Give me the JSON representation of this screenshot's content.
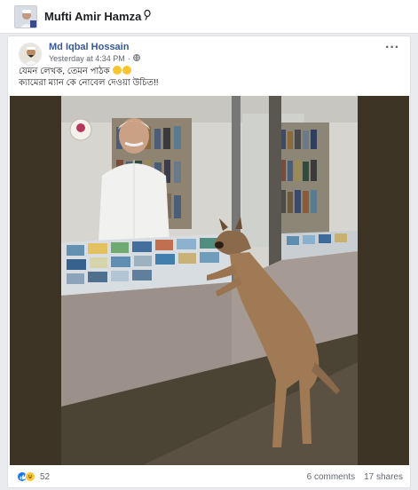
{
  "page": {
    "name": "Mufti Amir Hamza",
    "pin_icon": "pushpin-icon"
  },
  "post": {
    "author": "Md Iqbal Hossain",
    "timestamp": "Yesterday at 4:34 PM",
    "privacy_icon": "globe-icon",
    "text_line1": "যেমন লেখক, তেমন পাঠক",
    "text_line2": "ক্যামেরা ম্যান কে নোবেল দেওয়া উচিত!!",
    "emoji_icon": "grinning-face-icon",
    "menu_icon": "ellipsis-icon"
  },
  "stats": {
    "reaction_count": "52",
    "comments": "6 comments",
    "shares": "17 shares",
    "reaction_icons": [
      "like-icon",
      "haha-icon"
    ]
  },
  "colors": {
    "link": "#385898",
    "like": "#1877f2",
    "background": "#e9ebee"
  }
}
